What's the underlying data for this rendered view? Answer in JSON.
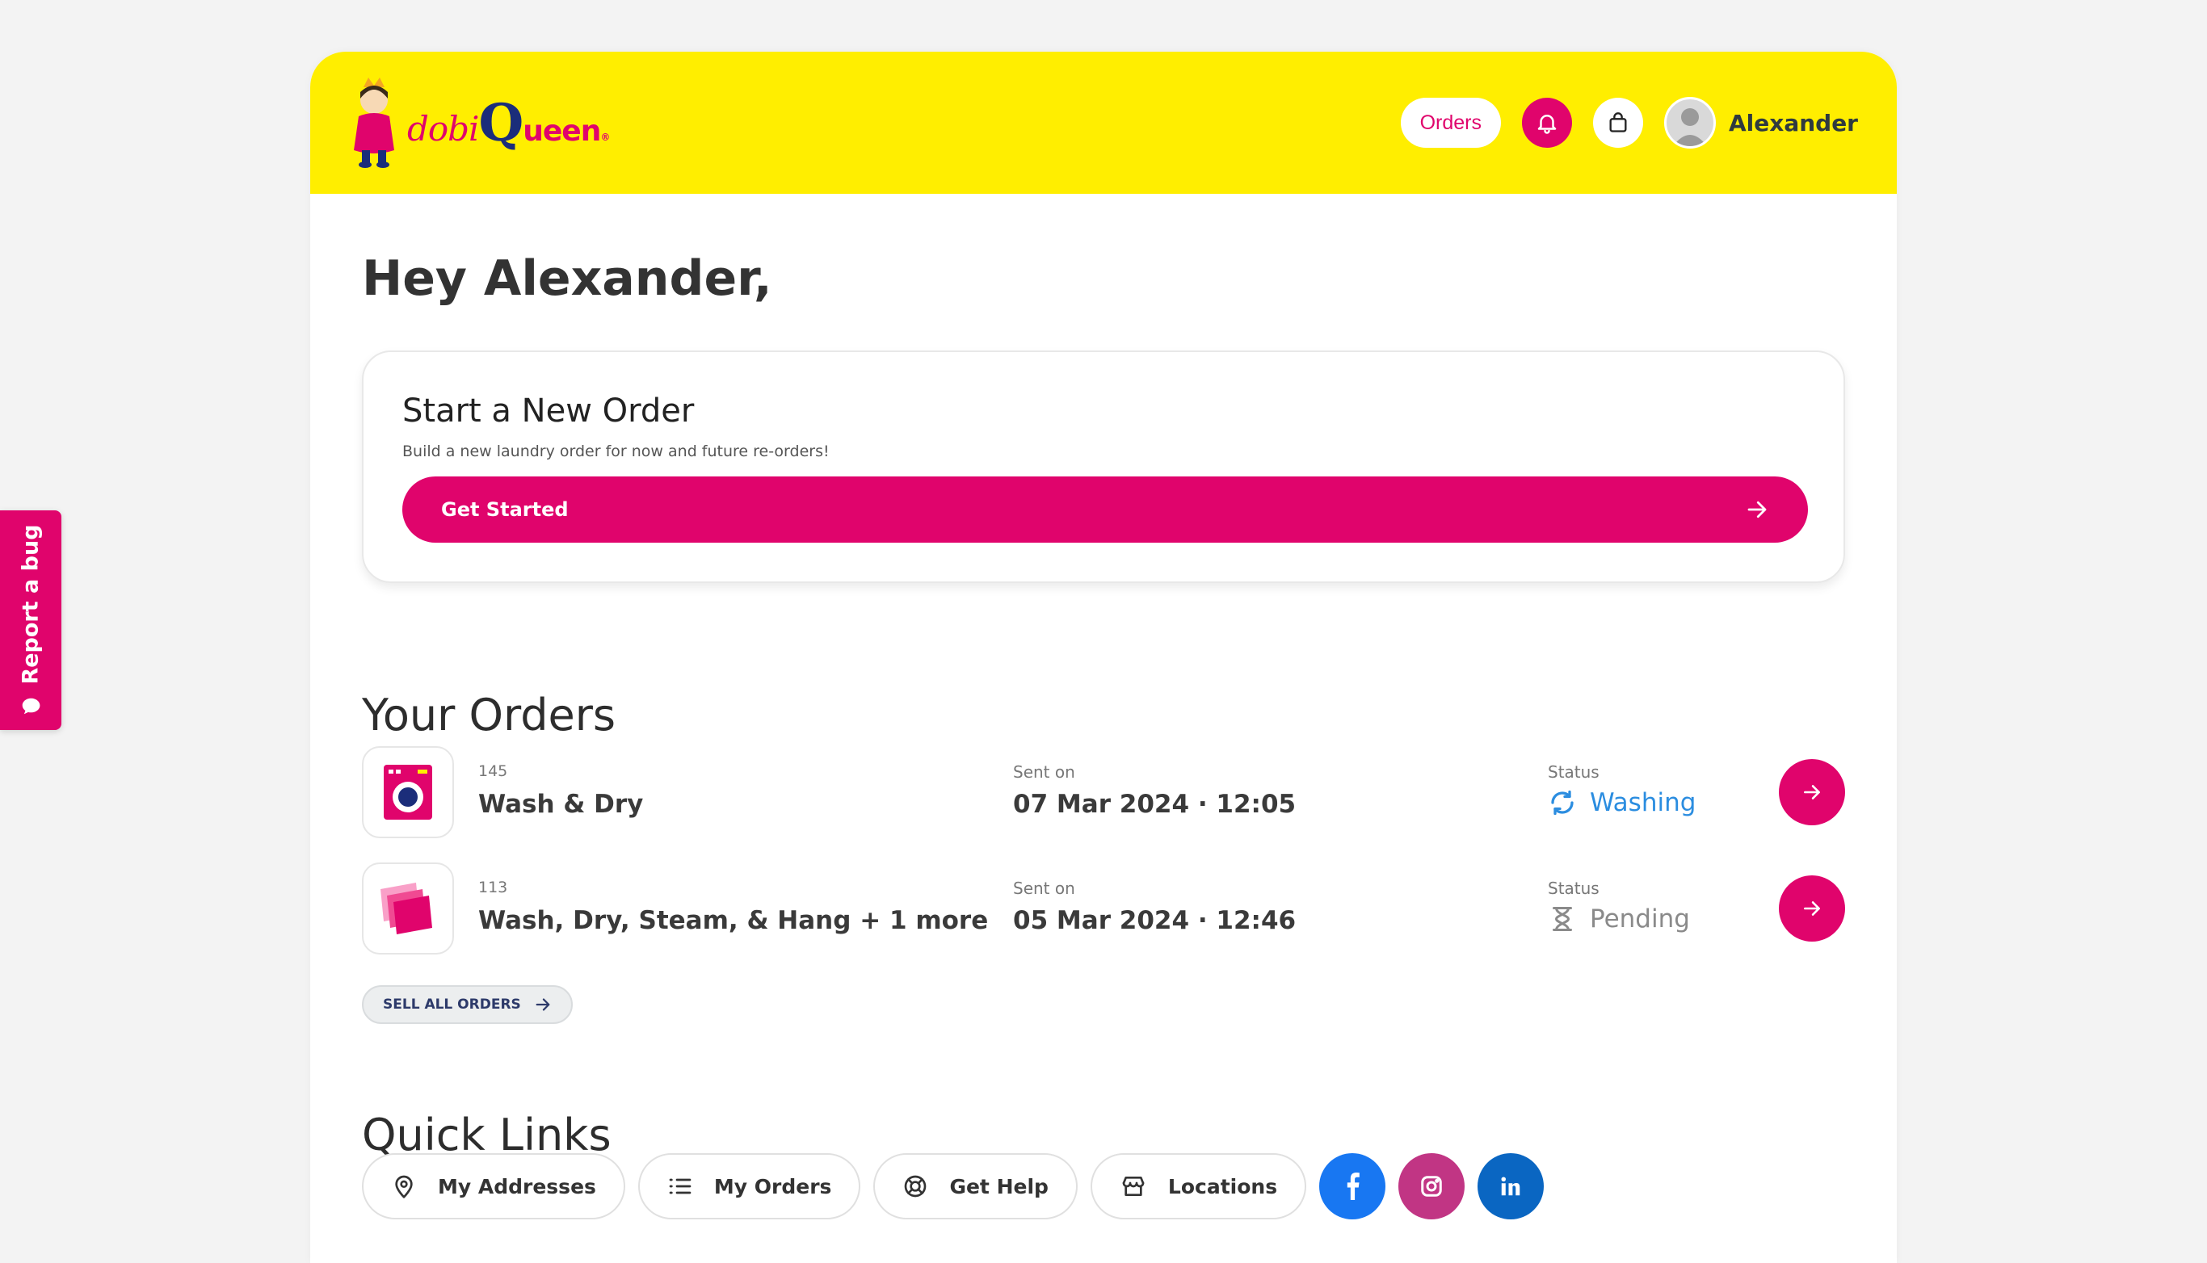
{
  "bug_tab": {
    "label": "Report a bug"
  },
  "header": {
    "logo": {
      "part1": "dobi",
      "part2": "Q",
      "part3": "ueen",
      "mark": "®"
    },
    "orders_button": "Orders",
    "user_name": "Alexander",
    "icons": [
      "bell-icon",
      "shopping-bag-icon",
      "avatar"
    ]
  },
  "greeting": "Hey Alexander,",
  "new_order": {
    "title": "Start a New Order",
    "subtitle": "Build a new laundry order for now and future re-orders!",
    "button": "Get Started"
  },
  "orders_section": {
    "title": "Your Orders",
    "sent_label": "Sent on",
    "status_label": "Status",
    "orders": [
      {
        "id": "145",
        "name": "Wash & Dry",
        "sent": "07 Mar 2024 · 12:05",
        "status": "Washing",
        "icon": "washing-machine-icon",
        "status_icon": "refresh-icon"
      },
      {
        "id": "113",
        "name": "Wash, Dry, Steam, & Hang + 1 more",
        "sent": "05 Mar 2024 · 12:46",
        "status": "Pending",
        "icon": "stacked-clothes-icon",
        "status_icon": "hourglass-icon"
      }
    ],
    "see_all": "SELL ALL ORDERS"
  },
  "quick_links": {
    "title": "Quick Links",
    "links": [
      {
        "label": "My Addresses",
        "icon": "location-pin-icon"
      },
      {
        "label": "My Orders",
        "icon": "list-icon"
      },
      {
        "label": "Get Help",
        "icon": "lifebuoy-icon"
      },
      {
        "label": "Locations",
        "icon": "store-icon"
      }
    ],
    "social": [
      {
        "name": "facebook",
        "color": "#1877f2"
      },
      {
        "name": "instagram",
        "color": "#c13584"
      },
      {
        "name": "linkedin",
        "color": "#0a66c2"
      }
    ]
  },
  "colors": {
    "brand_pink": "#e0046c",
    "header_yellow": "#ffee00",
    "washing_blue": "#2b8de0",
    "pending_gray": "#8a8a8a"
  }
}
